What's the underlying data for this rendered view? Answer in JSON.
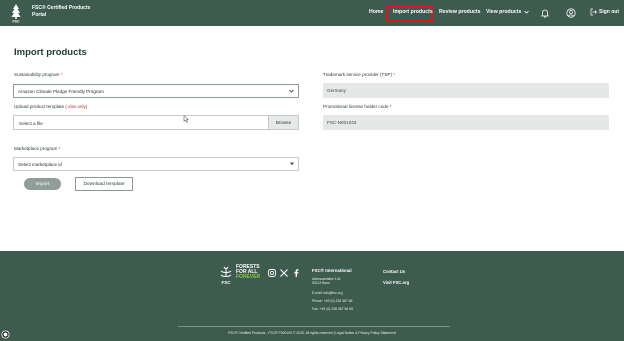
{
  "header": {
    "brand_line1": "FSC® Certified Products",
    "brand_line2": "Portal",
    "nav": {
      "home": "Home",
      "import": "Import products",
      "review": "Review products",
      "view": "View products"
    },
    "signout": "Sign out",
    "highlight_color": "#e0161b"
  },
  "main": {
    "title": "Import products",
    "sustainability": {
      "label": "Sustainability program",
      "required_mark": "*",
      "value": "Amazon Climate Pledge Friendly Program"
    },
    "upload": {
      "label": "Upload product template",
      "note": "(.xlsx only)",
      "placeholder": "Select a file",
      "browse": "Browse"
    },
    "marketplace": {
      "label": "Marketplace program",
      "required_mark": "*",
      "placeholder": "Select marketplace id"
    },
    "tsp": {
      "label": "Trademark service provider (TSP)",
      "required_mark": "*",
      "value": "Germany"
    },
    "license": {
      "label": "Promotional license holder code",
      "required_mark": "*",
      "value": "FSC-N001043"
    },
    "import_button": "Import",
    "download_button": "Download template"
  },
  "footer": {
    "slogan1": "FORESTS",
    "slogan2": "FOR ALL",
    "slogan3": "FOREVER",
    "logo_text": "FSC",
    "intl_title": "FSC® International",
    "address1": "Adenauerallee 134",
    "address2": "53113 Bonn",
    "email": "E-mail: info@fsc.org",
    "phone": "Phone: +49 (0) 228 367 66",
    "fax": "Fax: +49 (0) 228 367 66 65",
    "contact": "Contact Us",
    "visit": "Visit FSC.org",
    "copyright": "FSC® Certified Products - FSC® F000100 © 2025. All rights reserved | Legal Notice & Privacy Policy Statement",
    "accent_green": "#8ec641"
  },
  "colors": {
    "brand_green": "#3e5b4f"
  }
}
